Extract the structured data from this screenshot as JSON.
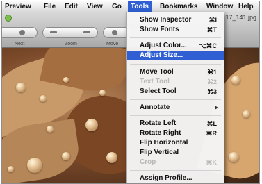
{
  "menubar": {
    "items": [
      "Preview",
      "File",
      "Edit",
      "View",
      "Go",
      "Tools",
      "Bookmarks",
      "Window",
      "Help"
    ],
    "active": "Tools"
  },
  "window": {
    "filename": "17_141.jpg"
  },
  "toolbar": {
    "labels": [
      "Next",
      "Zoom",
      "Move"
    ]
  },
  "tools_menu": {
    "items": [
      {
        "label": "Show Inspector",
        "shortcut": "⌘I",
        "state": "normal"
      },
      {
        "label": "Show Fonts",
        "shortcut": "⌘T",
        "state": "normal"
      },
      {
        "label": "Adjust Color...",
        "shortcut": "⌥⌘C",
        "state": "normal"
      },
      {
        "label": "Adjust Size...",
        "shortcut": "",
        "state": "highlighted"
      },
      {
        "label": "Move Tool",
        "shortcut": "⌘1",
        "state": "normal"
      },
      {
        "label": "Text Tool",
        "shortcut": "⌘2",
        "state": "disabled"
      },
      {
        "label": "Select Tool",
        "shortcut": "⌘3",
        "state": "normal"
      },
      {
        "label": "Annotate",
        "shortcut": "",
        "state": "submenu"
      },
      {
        "label": "Rotate Left",
        "shortcut": "⌘L",
        "state": "normal"
      },
      {
        "label": "Rotate Right",
        "shortcut": "⌘R",
        "state": "normal"
      },
      {
        "label": "Flip Horizontal",
        "shortcut": "",
        "state": "normal"
      },
      {
        "label": "Flip Vertical",
        "shortcut": "",
        "state": "normal"
      },
      {
        "label": "Crop",
        "shortcut": "⌘K",
        "state": "disabled"
      },
      {
        "label": "Assign Profile...",
        "shortcut": "",
        "state": "normal"
      }
    ]
  },
  "icons": {
    "zoom_light": "green-zoom-button-icon",
    "submenu_arrow": "chevron-right-icon"
  }
}
